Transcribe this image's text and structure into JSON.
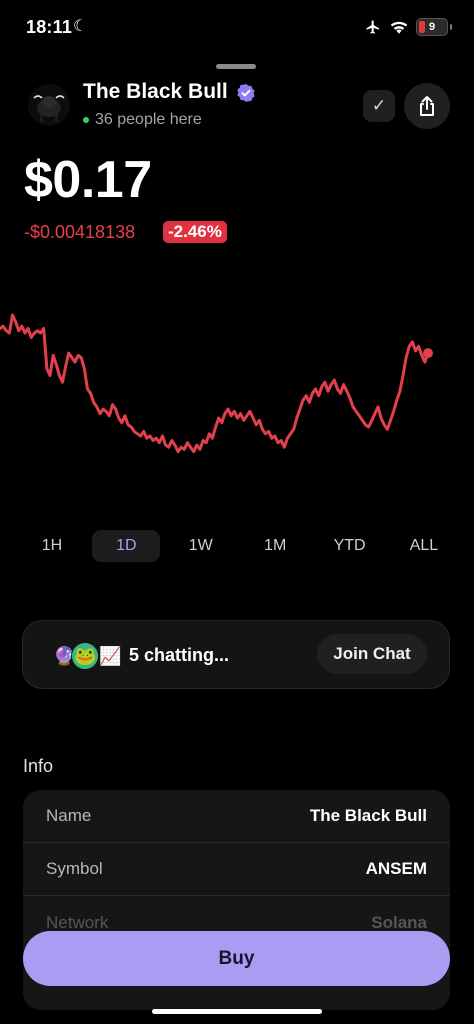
{
  "status_bar": {
    "time": "18:11",
    "battery": "9"
  },
  "header": {
    "token_name": "The Black Bull",
    "people_here": "36 people here"
  },
  "price": {
    "value": "$0.17",
    "change_abs": "-$0.00418138",
    "change_pct": "-2.46%"
  },
  "chart_data": {
    "type": "line",
    "series_color": "#e3404d",
    "y_relative": [
      0.73,
      0.74,
      0.72,
      0.71,
      0.79,
      0.76,
      0.72,
      0.74,
      0.71,
      0.73,
      0.69,
      0.71,
      0.72,
      0.71,
      0.73,
      0.55,
      0.52,
      0.61,
      0.57,
      0.52,
      0.49,
      0.56,
      0.62,
      0.6,
      0.58,
      0.61,
      0.6,
      0.55,
      0.46,
      0.44,
      0.4,
      0.38,
      0.35,
      0.37,
      0.36,
      0.34,
      0.39,
      0.37,
      0.33,
      0.31,
      0.34,
      0.3,
      0.29,
      0.27,
      0.26,
      0.25,
      0.27,
      0.24,
      0.25,
      0.23,
      0.24,
      0.22,
      0.25,
      0.21,
      0.2,
      0.23,
      0.21,
      0.18,
      0.2,
      0.19,
      0.22,
      0.2,
      0.18,
      0.21,
      0.19,
      0.23,
      0.22,
      0.26,
      0.24,
      0.29,
      0.33,
      0.31,
      0.35,
      0.37,
      0.34,
      0.36,
      0.33,
      0.35,
      0.32,
      0.34,
      0.36,
      0.33,
      0.3,
      0.32,
      0.28,
      0.26,
      0.27,
      0.24,
      0.25,
      0.22,
      0.23,
      0.2,
      0.24,
      0.26,
      0.28,
      0.33,
      0.37,
      0.41,
      0.43,
      0.4,
      0.44,
      0.46,
      0.43,
      0.47,
      0.49,
      0.45,
      0.48,
      0.5,
      0.46,
      0.44,
      0.48,
      0.45,
      0.42,
      0.38,
      0.36,
      0.34,
      0.32,
      0.3,
      0.29,
      0.32,
      0.35,
      0.38,
      0.33,
      0.3,
      0.28,
      0.32,
      0.36,
      0.41,
      0.45,
      0.52,
      0.6,
      0.65,
      0.67,
      0.63,
      0.65,
      0.61,
      0.58,
      0.62
    ]
  },
  "time_ranges": [
    "1H",
    "1D",
    "1W",
    "1M",
    "YTD",
    "ALL"
  ],
  "active_range": "1D",
  "chat": {
    "text": "5 chatting...",
    "join_label": "Join Chat"
  },
  "info": {
    "heading": "Info",
    "rows": [
      {
        "key": "Name",
        "value": "The Black Bull"
      },
      {
        "key": "Symbol",
        "value": "ANSEM"
      },
      {
        "key": "Network",
        "value": "Solana"
      }
    ]
  },
  "buy_label": "Buy",
  "colors": {
    "accent": "#a99cf2",
    "negative": "#e3404d",
    "online": "#35d35a"
  }
}
